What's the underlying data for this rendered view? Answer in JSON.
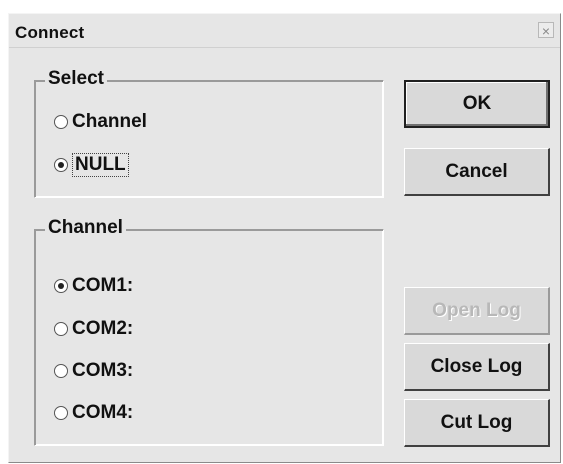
{
  "window": {
    "title": "Connect",
    "close_glyph": "×"
  },
  "select_group": {
    "legend": "Select",
    "options": [
      {
        "label": "Channel",
        "checked": false
      },
      {
        "label": "NULL",
        "checked": true
      }
    ]
  },
  "channel_group": {
    "legend": "Channel",
    "options": [
      {
        "label": "COM1:",
        "checked": true
      },
      {
        "label": "COM2:",
        "checked": false
      },
      {
        "label": "COM3:",
        "checked": false
      },
      {
        "label": "COM4:",
        "checked": false
      }
    ]
  },
  "buttons": {
    "ok": "OK",
    "cancel": "Cancel",
    "open_log": "Open Log",
    "close_log": "Close Log",
    "cut_log": "Cut Log"
  }
}
